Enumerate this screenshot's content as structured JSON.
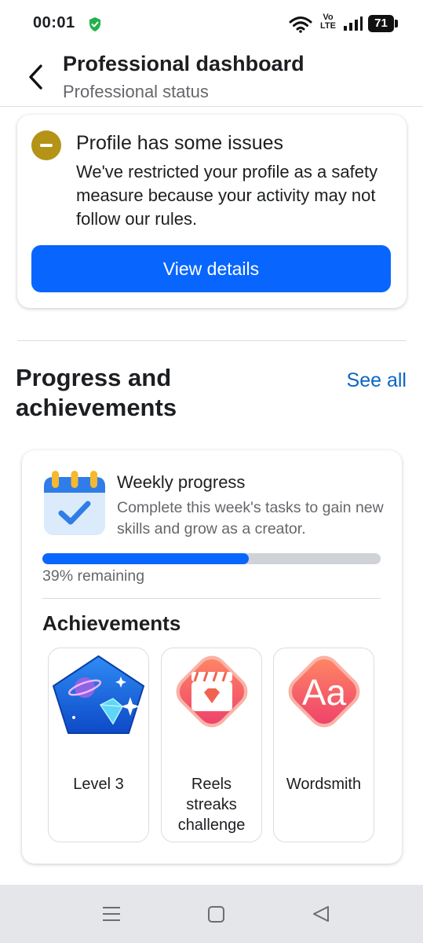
{
  "status_bar": {
    "time": "00:01",
    "network_label_top": "Vo",
    "network_label_bottom": "LTE",
    "battery": "71"
  },
  "header": {
    "title": "Professional dashboard",
    "subtitle": "Professional status"
  },
  "issue_card": {
    "title": "Profile has some issues",
    "body": "We've restricted your profile as a safety measure because your activity may not follow our rules.",
    "button_label": "View details"
  },
  "progress_section": {
    "title": "Progress and achievements",
    "see_all_label": "See all"
  },
  "weekly_progress": {
    "title": "Weekly progress",
    "description": "Complete this week's tasks to gain new skills and grow as a creator.",
    "completed_fraction": 0.61,
    "remaining_label": "39% remaining"
  },
  "achievements": {
    "title": "Achievements",
    "items": [
      {
        "label": "Level 3",
        "icon": "planet-gem-badge-icon"
      },
      {
        "label": "Reels streaks challenge",
        "icon": "clapperboard-gem-badge-icon"
      },
      {
        "label": "Wordsmith",
        "icon": "text-aa-badge-icon"
      }
    ]
  },
  "colors": {
    "accent": "#0866ff",
    "link": "#0a66c2",
    "warning": "#b49316",
    "badge_blue": "#1565e0",
    "badge_coral": "#f2634f"
  }
}
